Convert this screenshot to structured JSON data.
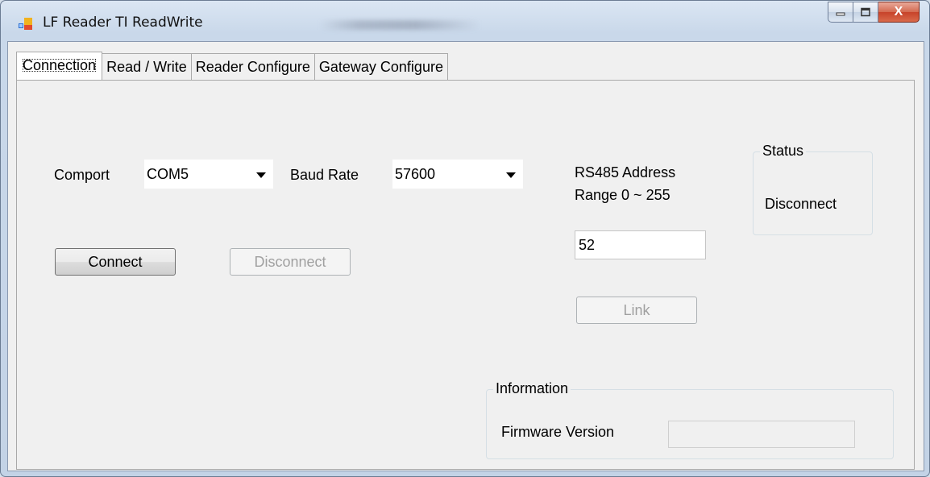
{
  "window": {
    "title": "LF Reader TI ReadWrite",
    "close_glyph": "X"
  },
  "tabs": [
    {
      "label": "Connection",
      "active": true
    },
    {
      "label": "Read / Write",
      "active": false
    },
    {
      "label": "Reader Configure",
      "active": false
    },
    {
      "label": "Gateway Configure",
      "active": false
    }
  ],
  "connection": {
    "comport_label": "Comport",
    "comport_value": "COM5",
    "baud_label": "Baud Rate",
    "baud_value": "57600",
    "connect_label": "Connect",
    "disconnect_label": "Disconnect",
    "rs485_label": "RS485 Address",
    "rs485_range": "Range 0 ~ 255",
    "rs485_value": "52",
    "link_label": "Link",
    "status_title": "Status",
    "status_value": "Disconnect",
    "info_title": "Information",
    "firmware_label": "Firmware Version",
    "firmware_value": ""
  }
}
